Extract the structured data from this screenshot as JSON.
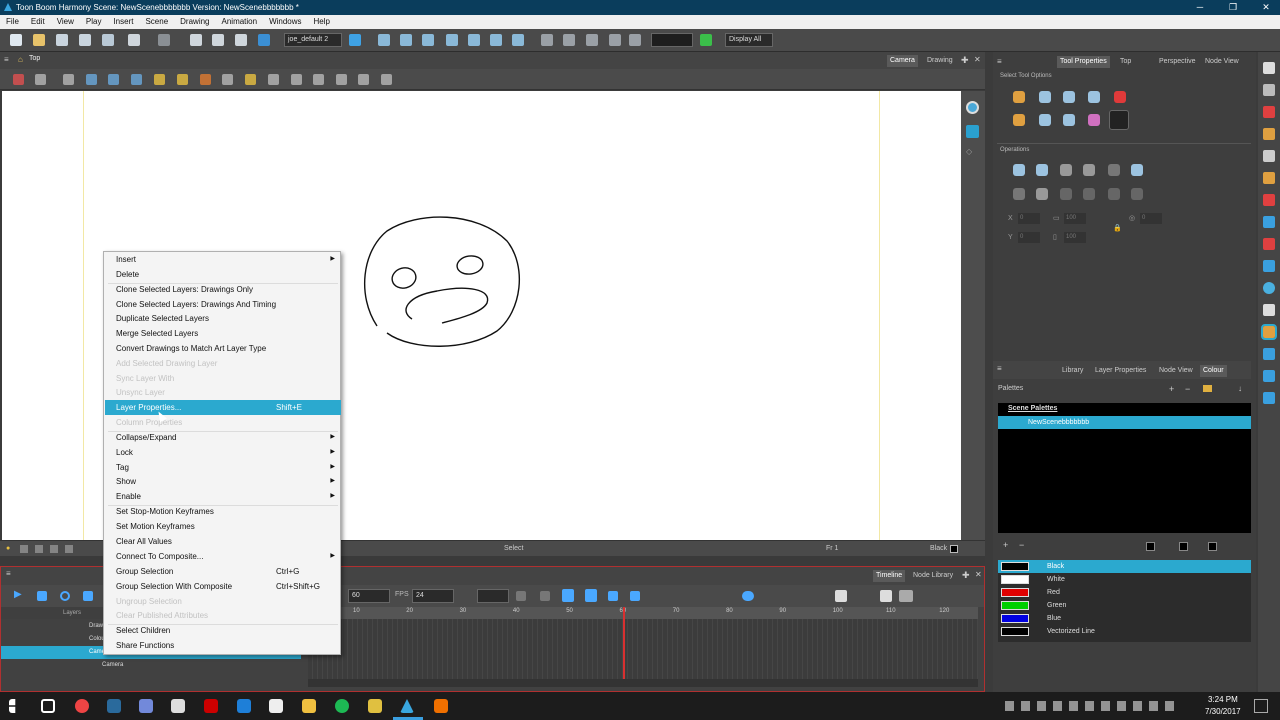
{
  "window": {
    "title": "Toon Boom Harmony Scene: NewScenebbbbbbb Version: NewScenebbbbbbb *"
  },
  "menu": [
    "File",
    "Edit",
    "View",
    "Play",
    "Insert",
    "Scene",
    "Drawing",
    "Animation",
    "Windows",
    "Help"
  ],
  "toolbar": {
    "preset": "joe_default 2",
    "display": "Display All"
  },
  "camera_view": {
    "view_label": "Top",
    "tabs": [
      "Camera",
      "Drawing"
    ]
  },
  "statusbar": {
    "mode": "Select",
    "frame": "Fr 1",
    "colour": "Black"
  },
  "context_menu": {
    "items": [
      {
        "label": "Insert",
        "submenu": true
      },
      {
        "label": "Delete"
      },
      {
        "label": "Clone Selected Layers: Drawings Only"
      },
      {
        "label": "Clone Selected Layers: Drawings And Timing"
      },
      {
        "label": "Duplicate Selected Layers"
      },
      {
        "label": "Merge Selected Layers"
      },
      {
        "label": "Convert Drawings to Match Art Layer Type"
      },
      {
        "label": "Add Selected Drawing Layer",
        "disabled": true
      },
      {
        "label": "Sync Layer With",
        "disabled": true
      },
      {
        "label": "Unsync Layer",
        "disabled": true
      },
      {
        "label": "Layer Properties...",
        "shortcut": "Shift+E",
        "highlighted": true
      },
      {
        "label": "Column Properties",
        "disabled": true
      },
      {
        "label": "Collapse/Expand",
        "submenu": true
      },
      {
        "label": "Lock",
        "submenu": true
      },
      {
        "label": "Tag",
        "submenu": true
      },
      {
        "label": "Show",
        "submenu": true
      },
      {
        "label": "Enable",
        "submenu": true
      },
      {
        "label": "Set Stop-Motion Keyframes"
      },
      {
        "label": "Set Motion Keyframes"
      },
      {
        "label": "Clear All Values"
      },
      {
        "label": "Connect To Composite...",
        "submenu": true
      },
      {
        "label": "Group Selection",
        "shortcut": "Ctrl+G"
      },
      {
        "label": "Group Selection With Composite",
        "shortcut": "Ctrl+Shift+G"
      },
      {
        "label": "Ungroup Selection",
        "disabled": true
      },
      {
        "label": "Clear Published Attributes",
        "disabled": true
      },
      {
        "label": "Select Children"
      },
      {
        "label": "Share Functions"
      }
    ]
  },
  "timeline": {
    "tabs": [
      "Timeline",
      "Node Library"
    ],
    "end_frame": "60",
    "fps_label": "FPS",
    "fps": "24",
    "layers_label": "Layers",
    "layers": [
      "Drawing",
      "Colour",
      "Camera",
      "Camera"
    ],
    "ruler": [
      "10",
      "20",
      "30",
      "40",
      "50",
      "60",
      "70",
      "80",
      "90",
      "100",
      "110",
      "120"
    ]
  },
  "tool_properties": {
    "tabs": [
      "Tool Properties",
      "Top",
      "Perspective",
      "Node View"
    ],
    "select_label": "Select Tool Options",
    "operations_label": "Operations",
    "fields": [
      "0",
      "100",
      "0",
      "0",
      "100",
      "0"
    ]
  },
  "colour_panel": {
    "tabs": [
      "Library",
      "Layer Properties",
      "Node View",
      "Colour"
    ],
    "palettes_label": "Palettes",
    "scene_palettes": "Scene Palettes",
    "palette_name": "NewScenebbbbbbb",
    "colours": [
      {
        "name": "Black",
        "hex": "#000000",
        "selected": true
      },
      {
        "name": "White",
        "hex": "#ffffff"
      },
      {
        "name": "Red",
        "hex": "#e00000"
      },
      {
        "name": "Green",
        "hex": "#00d000"
      },
      {
        "name": "Blue",
        "hex": "#0000e0"
      },
      {
        "name": "Vectorized Line",
        "hex": "#000000"
      }
    ]
  },
  "taskbar": {
    "time": "3:24 PM",
    "date": "7/30/2017"
  },
  "colors": {
    "accent": "#2ba9cf",
    "titlebar": "#0a3d5c",
    "timeline_border": "#b03030"
  }
}
